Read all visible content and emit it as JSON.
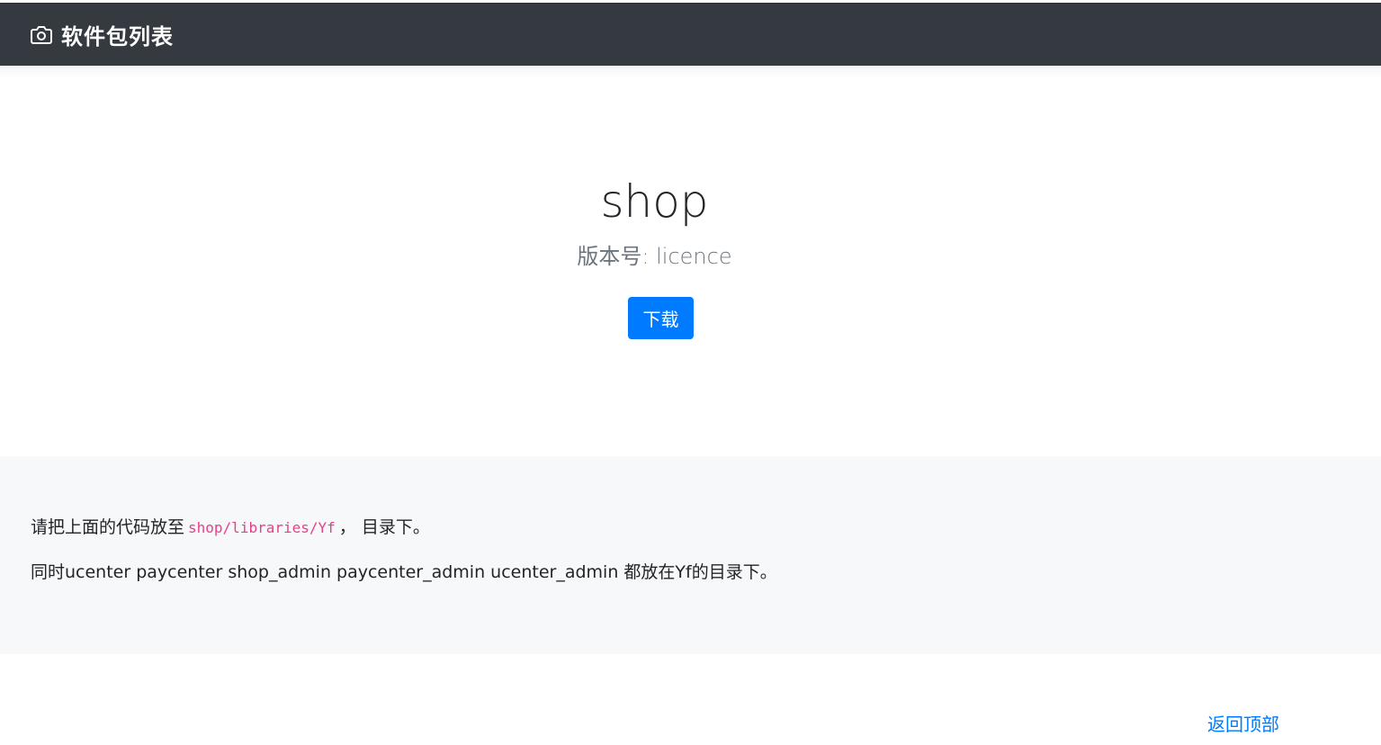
{
  "navbar": {
    "brand_icon": "camera-icon",
    "brand_label": "软件包列表",
    "background": "#343a40"
  },
  "jumbotron": {
    "title": "shop",
    "version_label": "版本号: licence",
    "download_label": "下载",
    "button_color": "#007bff"
  },
  "info": {
    "line1_before": "请把上面的代码放至",
    "line1_code": "shop/libraries/Yf",
    "line1_after": "， 目录下。",
    "line2": "同时ucenter paycenter shop_admin paycenter_admin ucenter_admin 都放在Yf的目录下。"
  },
  "footer": {
    "back_to_top": "返回顶部"
  }
}
